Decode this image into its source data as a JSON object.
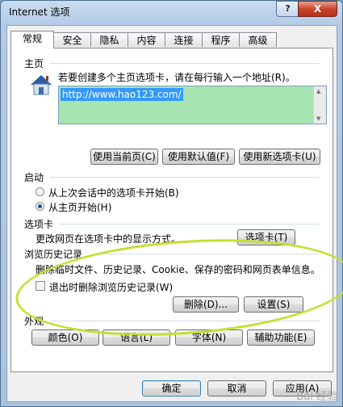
{
  "window": {
    "title": "Internet 选项",
    "help_glyph": "?",
    "close_glyph": "X"
  },
  "tabs": [
    "常规",
    "安全",
    "隐私",
    "内容",
    "连接",
    "程序",
    "高级"
  ],
  "homepage": {
    "header": "主页",
    "instruction": "若要创建多个主页选项卡，请在每行输入一个地址(R)。",
    "url": "http://www.hao123.com/",
    "buttons": [
      "使用当前页(C)",
      "使用默认值(F)",
      "使用新选项卡(U)"
    ]
  },
  "startup": {
    "header": "启动",
    "options": [
      {
        "label": "从上次会话中的选项卡开始(B)",
        "selected": false
      },
      {
        "label": "从主页开始(H)",
        "selected": true
      }
    ]
  },
  "tabs_section": {
    "header": "选项卡",
    "description": "更改网页在选项卡中的显示方式。",
    "button": "选项卡(T)"
  },
  "history": {
    "header": "浏览历史记录",
    "description": "删除临时文件、历史记录、Cookie、保存的密码和网页表单信息。",
    "checkbox_label": "退出时删除浏览历史记录(W)",
    "checkbox_checked": false,
    "delete_button": "删除(D)...",
    "settings_button": "设置(S)"
  },
  "appearance": {
    "header": "外观",
    "buttons": [
      "颜色(O)",
      "语言(L)",
      "字体(N)",
      "辅助功能(E)"
    ]
  },
  "footer": {
    "ok": "确定",
    "cancel": "取消",
    "apply": "应用(A)"
  },
  "watermark": "Bai 经验",
  "colors": {
    "title_bar": "#b3cbe6",
    "close_button": "#c9462c",
    "url_selection": "#3399ff",
    "highlight_oval": "#c6df33",
    "url_overlay": "#98e0a5"
  }
}
